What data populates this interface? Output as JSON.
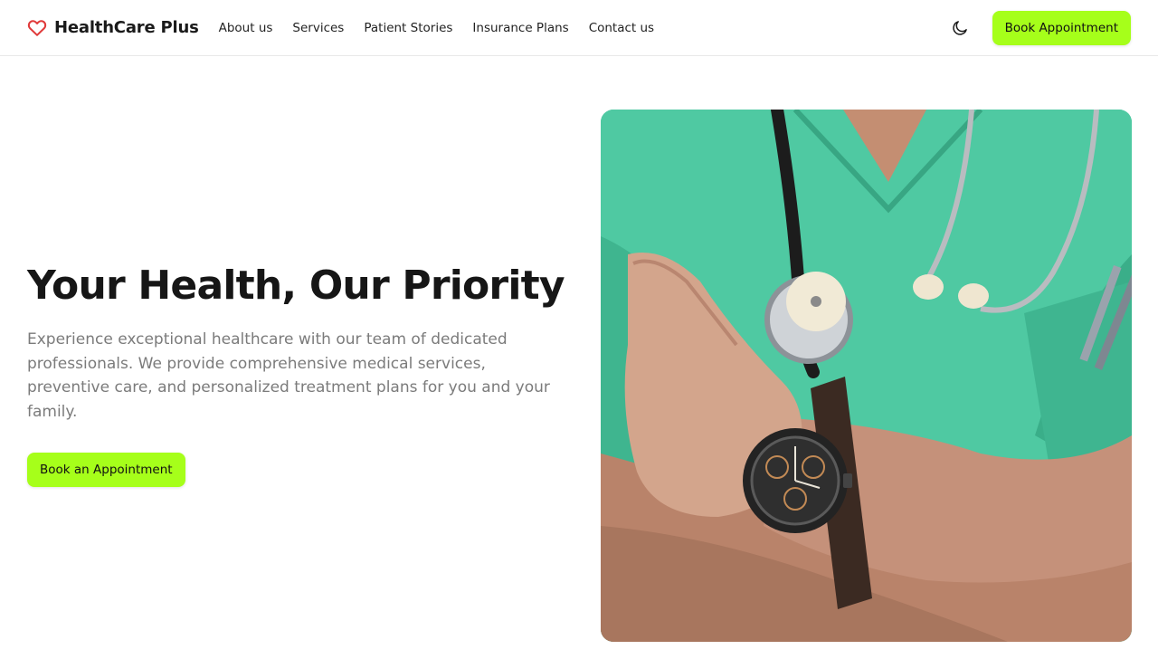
{
  "header": {
    "brand": "HealthCare Plus",
    "brand_icon": "heart-outline-icon",
    "nav": [
      {
        "label": "About us"
      },
      {
        "label": "Services"
      },
      {
        "label": "Patient Stories"
      },
      {
        "label": "Insurance Plans"
      },
      {
        "label": "Contact us"
      }
    ],
    "theme_toggle_icon": "moon-icon",
    "cta_label": "Book Appointment"
  },
  "hero": {
    "title": "Your Health, Our Priority",
    "description": "Experience exceptional healthcare with our team of dedicated professionals. We provide comprehensive medical services, preventive care, and personalized treatment plans for you and your family.",
    "cta_label": "Book an Appointment",
    "image_subject": "doctor-with-stethoscope-image"
  },
  "colors": {
    "accent": "#a6ff1a",
    "brand_icon": "#e03a3a",
    "scrubs": "#49c39c",
    "text_dark": "#161616",
    "text_muted": "#7b7b7b"
  }
}
